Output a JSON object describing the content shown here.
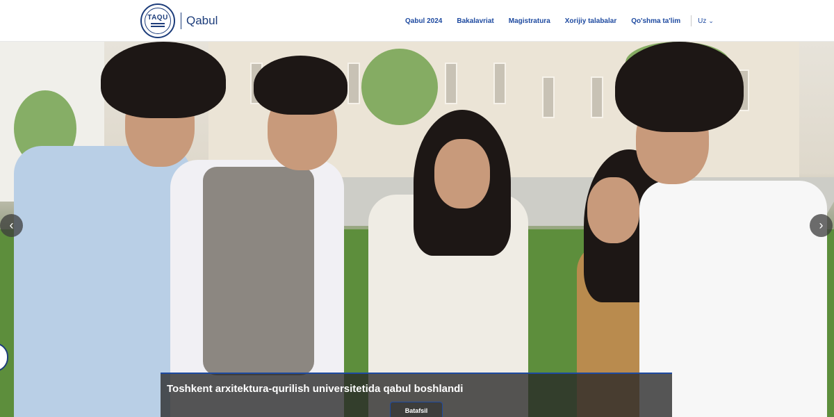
{
  "header": {
    "logo_text": "TAQU",
    "brand_name": "Qabul"
  },
  "nav": {
    "items": [
      "Qabul 2024",
      "Bakalavriat",
      "Magistratura",
      "Xorijiy talabalar",
      "Qo'shma ta'lim"
    ],
    "language": "Uz"
  },
  "hero": {
    "caption_title": "Toshkent arxitektura-qurilish universitetida qabul boshlandi",
    "button_label": "Batafsil"
  },
  "icons": {
    "prev": "chevron-left-icon",
    "next": "chevron-right-icon",
    "lang": "chevron-down-icon"
  },
  "colors": {
    "brand": "#1c3c7a",
    "nav_link": "#1e4aa0",
    "caption_bg": "#282828"
  }
}
